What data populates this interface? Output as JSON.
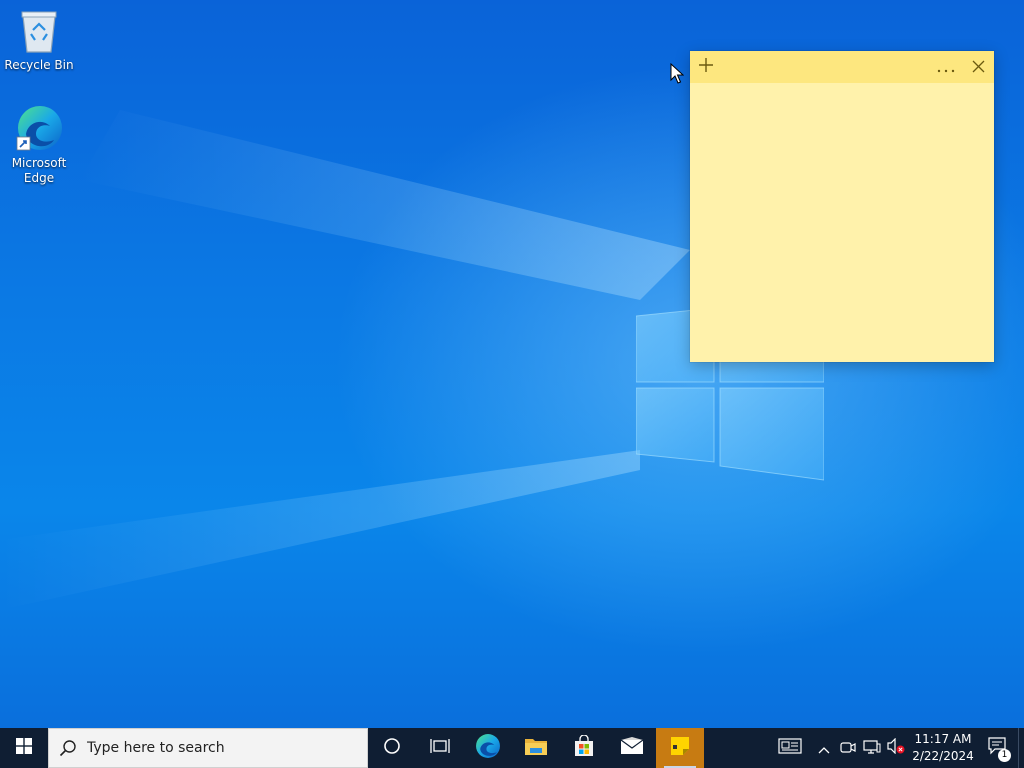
{
  "desktop": {
    "icons": [
      {
        "label": "Recycle Bin"
      },
      {
        "label": "Microsoft Edge"
      }
    ]
  },
  "sticky_note": {
    "add_icon": "plus-icon",
    "menu_icon": "ellipsis-icon",
    "close_icon": "close-icon",
    "body_text": "",
    "bar_color": "#fde77f",
    "body_color": "#fff2ab"
  },
  "taskbar": {
    "search_placeholder": "Type here to search",
    "apps": [
      {
        "name": "cortana",
        "icon": "circle-icon"
      },
      {
        "name": "task-view",
        "icon": "task-view-icon"
      },
      {
        "name": "edge",
        "icon": "edge-icon"
      },
      {
        "name": "file-explorer",
        "icon": "folder-icon"
      },
      {
        "name": "microsoft-store",
        "icon": "store-icon"
      },
      {
        "name": "mail",
        "icon": "mail-icon"
      },
      {
        "name": "sticky-notes",
        "icon": "sticky-notes-icon",
        "active": true
      }
    ],
    "tray": {
      "time": "11:17 AM",
      "date": "2/22/2024",
      "notification_count": "1"
    },
    "active_color": "#c77b12"
  }
}
